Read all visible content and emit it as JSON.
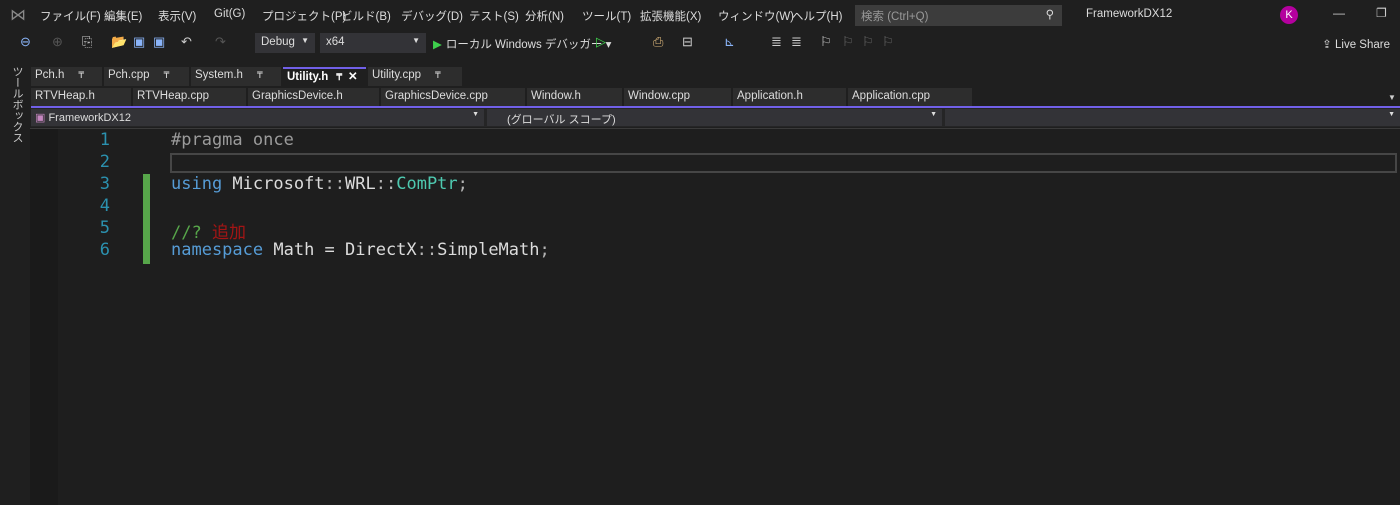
{
  "menu": [
    "ファイル(F)",
    "編集(E)",
    "表示(V)",
    "Git(G)",
    "プロジェクト(P)",
    "ビルド(B)",
    "デバッグ(D)",
    "テスト(S)",
    "分析(N)",
    "ツール(T)",
    "拡張機能(X)",
    "ウィンドウ(W)",
    "ヘルプ(H)"
  ],
  "search": {
    "placeholder": "検索 (Ctrl+Q)"
  },
  "solution_title": "FrameworkDX12",
  "avatar": "K",
  "toolbar": {
    "config": "Debug",
    "platform": "x64",
    "run": "ローカル Windows デバッガー",
    "live_share": "Live Share"
  },
  "toolbox": "ツールボックス",
  "tabs_row1": [
    {
      "label": "Pch.h"
    },
    {
      "label": "Pch.cpp"
    },
    {
      "label": "System.h"
    },
    {
      "label": "Utility.h",
      "active": true
    },
    {
      "label": "Utility.cpp"
    }
  ],
  "tabs_row2": [
    "RTVHeap.h",
    "RTVHeap.cpp",
    "GraphicsDevice.h",
    "GraphicsDevice.cpp",
    "Window.h",
    "Window.cpp",
    "Application.h",
    "Application.cpp"
  ],
  "nav": {
    "project": "FrameworkDX12",
    "scope": "(グローバル スコープ)"
  },
  "code": {
    "l1": "#pragma once",
    "l3a": "using",
    " l3b": "",
    "using": "using",
    "ms": " Microsoft",
    "sep": "::",
    "wrl": "WRL",
    "comptr": "ComPtr",
    "semi": ";",
    "comment": "//? ",
    "comment_jp": "追加",
    "namespace": "namespace",
    "math": " Math = DirectX",
    "simplemath": "SimpleMath"
  },
  "line_numbers": [
    "1",
    "2",
    "3",
    "4",
    "5",
    "6"
  ]
}
